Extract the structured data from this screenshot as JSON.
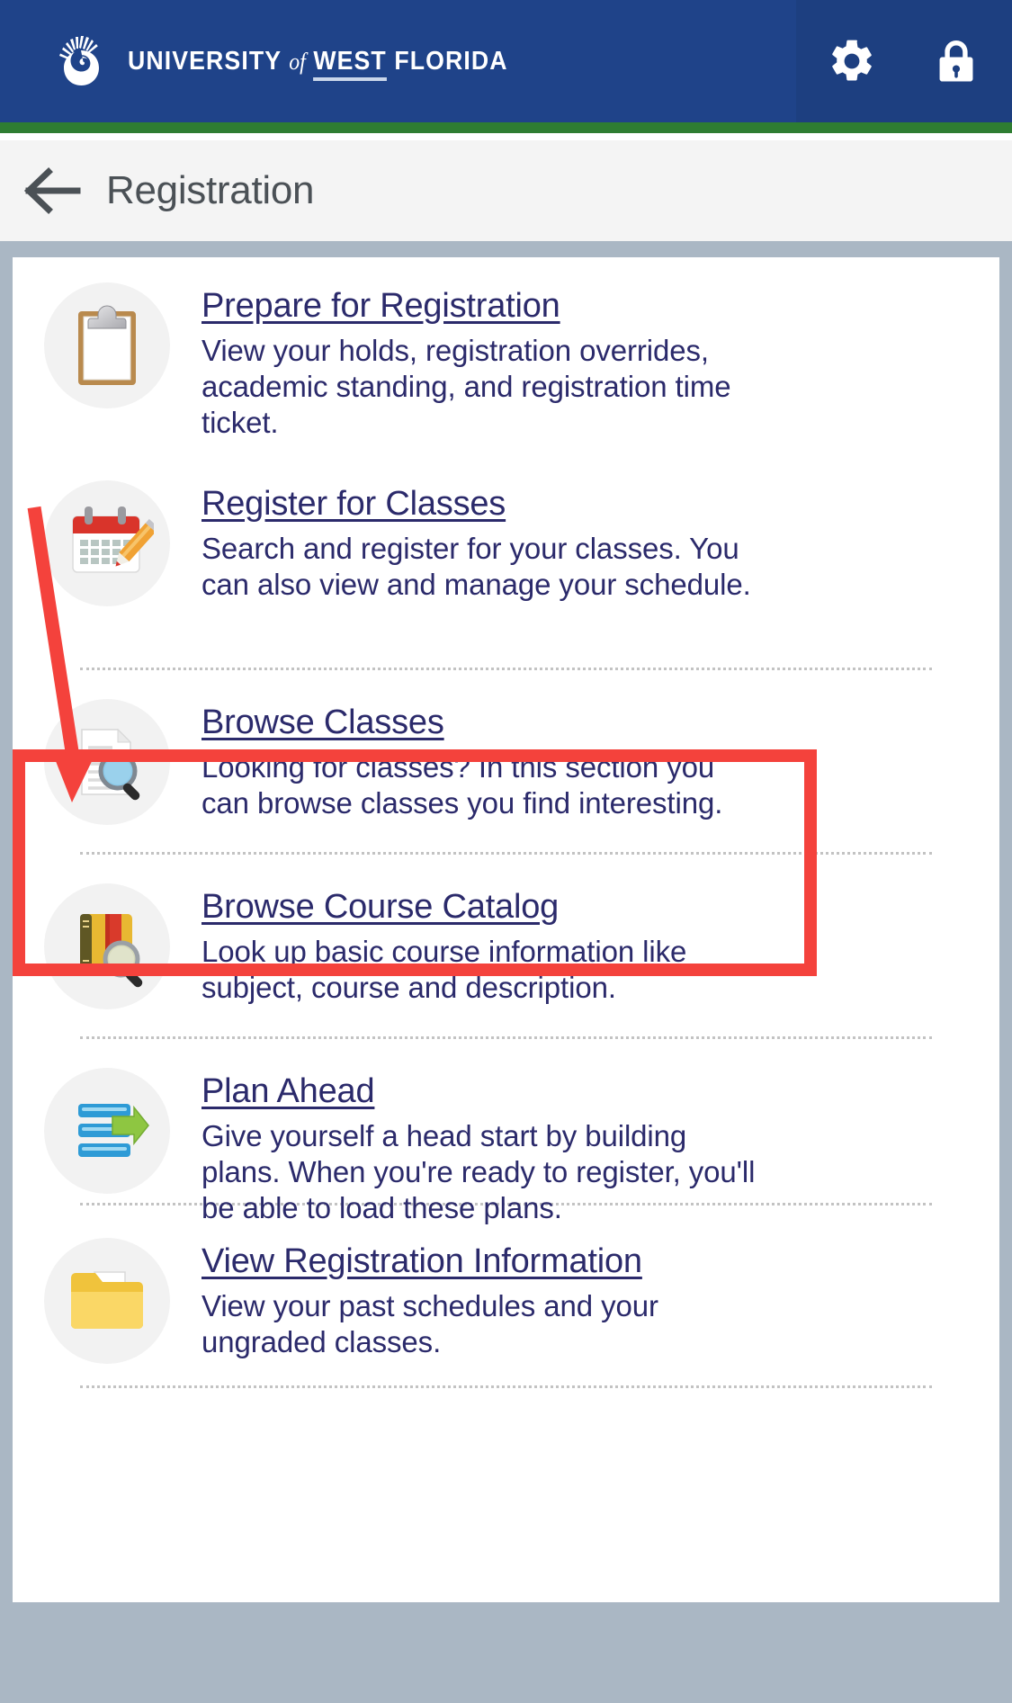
{
  "header": {
    "logo_icon": "nautilus-shell-logo",
    "brand_line1": "UNIVERSITY",
    "brand_of": "of",
    "brand_west": "WEST",
    "brand_florida": "FLORIDA",
    "settings_icon": "gear-icon",
    "lock_icon": "lock-icon",
    "bg_color": "#1f4389",
    "accent_green": "#2e7d32"
  },
  "titlebar": {
    "back_icon": "back-arrow-icon",
    "title": "Registration"
  },
  "registration": {
    "items": [
      {
        "icon": "clipboard-icon",
        "title": "Prepare for Registration",
        "description": "View your holds, registration overrides, academic standing, and registration time ticket."
      },
      {
        "icon": "calendar-pencil-icon",
        "title": "Register for Classes",
        "description": "Search and register for your classes. You can also view and manage your schedule."
      },
      {
        "icon": "document-search-icon",
        "title": "Browse Classes",
        "description": "Looking for classes? In this section you can browse classes you find interesting."
      },
      {
        "icon": "book-search-icon",
        "title": "Browse Course Catalog",
        "description": "Look up basic course information like subject, course and description."
      },
      {
        "icon": "plan-list-arrow-icon",
        "title": "Plan Ahead",
        "description": "Give yourself a head start by building plans. When you're ready to register, you'll be able to load these plans."
      },
      {
        "icon": "folder-icon",
        "title": "View Registration Information",
        "description": "View your past schedules and your ungraded classes."
      }
    ]
  },
  "annotation": {
    "highlight_color": "#f4423c",
    "highlight_target": "Register for Classes",
    "arrow_icon": "red-pointer-arrow"
  }
}
